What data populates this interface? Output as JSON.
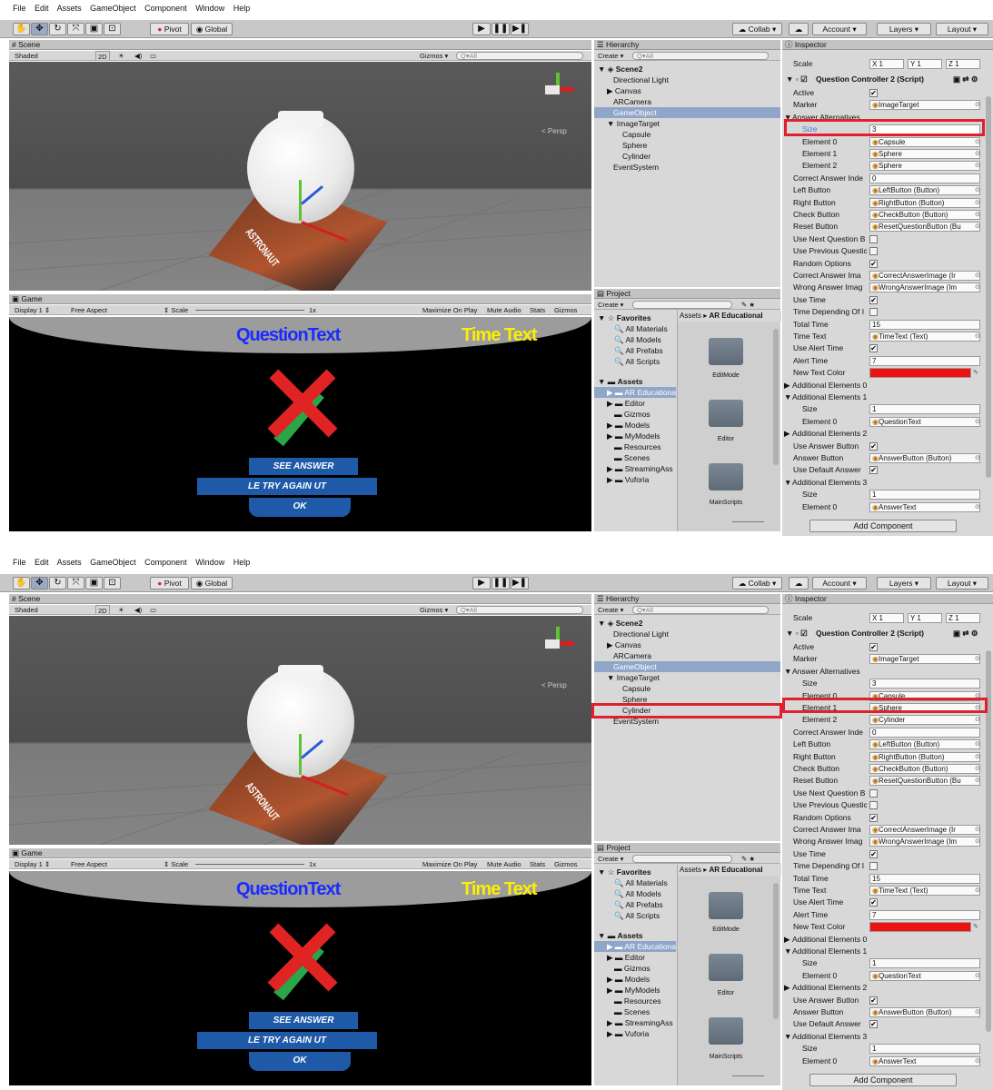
{
  "menu": [
    "File",
    "Edit",
    "Assets",
    "GameObject",
    "Component",
    "Window",
    "Help"
  ],
  "toolbar": {
    "pivot": "Pivot",
    "global": "Global",
    "collab": "Collab",
    "account": "Account",
    "layers": "Layers",
    "layout": "Layout",
    "play": "▶",
    "pause": "❚❚",
    "step": "▶❚"
  },
  "scene": {
    "tab": "Scene",
    "shading": "Shaded",
    "mode2d": "2D",
    "gizmos": "Gizmos",
    "search": "All",
    "persp": "< Persp",
    "card_label": "ASTRONAUT"
  },
  "game": {
    "tab": "Game",
    "display": "Display 1",
    "aspect": "Free Aspect",
    "scale": "Scale",
    "scale_val": "1x",
    "maximize": "Maximize On Play",
    "mute": "Mute Audio",
    "stats": "Stats",
    "gizmos": "Gizmos",
    "question_text": "QuestionText",
    "time_text": "Time Text",
    "see_answer": "SEE ANSWER",
    "try_again": "LE  TRY AGAIN  UT",
    "ok": "OK"
  },
  "hierarchy": {
    "tab": "Hierarchy",
    "create": "Create",
    "search": "All",
    "scene": "Scene2",
    "items": [
      "Directional Light",
      "Canvas",
      "ARCamera",
      "GameObject",
      "ImageTarget",
      "Capsule",
      "Sphere",
      "Cylinder",
      "EventSystem"
    ]
  },
  "project": {
    "tab": "Project",
    "create": "Create",
    "favorites": "Favorites",
    "fav_items": [
      "All Materials",
      "All Models",
      "All Prefabs",
      "All Scripts"
    ],
    "assets": "Assets",
    "asset_items": [
      "AR Educationa",
      "Editor",
      "Gizmos",
      "Models",
      "MyModels",
      "Resources",
      "Scenes",
      "StreamingAss",
      "Vuforia"
    ],
    "breadcrumb_root": "Assets",
    "breadcrumb_current": "AR Educational",
    "folders": [
      "EditMode",
      "Editor",
      "MainScripts"
    ]
  },
  "inspector_common": {
    "tab": "Inspector",
    "component": "Question Controller 2 (Script)",
    "add_component": "Add Component",
    "scale_label": "Scale",
    "sx": "X 1",
    "sy": "Y 1",
    "sz": "Z 1"
  },
  "shot1": {
    "rows": [
      [
        "Active",
        "chk"
      ],
      [
        "Marker",
        "ImageTarget"
      ],
      [
        "Answer Alternatives",
        ""
      ],
      [
        "Size",
        "3"
      ],
      [
        "Element 0",
        "Capsule"
      ],
      [
        "Element 1",
        "Sphere"
      ],
      [
        "Element 2",
        "Sphere"
      ],
      [
        "Correct Answer Inde",
        "0"
      ],
      [
        "Left Button",
        "LeftButton (Button)"
      ],
      [
        "Right Button",
        "RightButton (Button)"
      ],
      [
        "Check Button",
        "CheckButton (Button)"
      ],
      [
        "Reset Button",
        "ResetQuestionButton (Bu"
      ],
      [
        "Use Next Question B",
        "box"
      ],
      [
        "Use Previous Questic",
        "box"
      ],
      [
        "Random Options",
        "chk"
      ],
      [
        "Correct Answer Ima",
        "CorrectAnswerImage (Ir"
      ],
      [
        "Wrong Answer Imag",
        "WrongAnswerImage (Im"
      ],
      [
        "Use Time",
        "chk"
      ],
      [
        "Time Depending Of I",
        "box"
      ],
      [
        "Total Time",
        "15"
      ],
      [
        "Time Text",
        "TimeText (Text)"
      ],
      [
        "Use Alert Time",
        "chk"
      ],
      [
        "Alert Time",
        "7"
      ],
      [
        "New Text Color",
        "color"
      ],
      [
        "Additional Elements 0",
        ""
      ],
      [
        "Additional Elements 1",
        ""
      ],
      [
        "Size",
        "1"
      ],
      [
        "Element 0",
        "QuestionText"
      ],
      [
        "Additional Elements 2",
        ""
      ],
      [
        "Use Answer Button",
        "chk"
      ],
      [
        "Answer Button",
        "AnswerButton (Button)"
      ],
      [
        "Use Default Answer",
        "chk"
      ],
      [
        "Additional Elements 3",
        ""
      ],
      [
        "Size",
        "1"
      ],
      [
        "Element 0",
        "AnswerText"
      ]
    ]
  },
  "shot2": {
    "rows": [
      [
        "Active",
        "chk"
      ],
      [
        "Marker",
        "ImageTarget"
      ],
      [
        "Answer Alternatives",
        ""
      ],
      [
        "Size",
        "3"
      ],
      [
        "Element 0",
        "Capsule"
      ],
      [
        "Element 1",
        "Sphere"
      ],
      [
        "Element 2",
        "Cylinder"
      ],
      [
        "Correct Answer Inde",
        "0"
      ],
      [
        "Left Button",
        "LeftButton (Button)"
      ],
      [
        "Right Button",
        "RightButton (Button)"
      ],
      [
        "Check Button",
        "CheckButton (Button)"
      ],
      [
        "Reset Button",
        "ResetQuestionButton (Bu"
      ],
      [
        "Use Next Question B",
        "box"
      ],
      [
        "Use Previous Questic",
        "box"
      ],
      [
        "Random Options",
        "chk"
      ],
      [
        "Correct Answer Ima",
        "CorrectAnswerImage (Ir"
      ],
      [
        "Wrong Answer Imag",
        "WrongAnswerImage (Im"
      ],
      [
        "Use Time",
        "chk"
      ],
      [
        "Time Depending Of I",
        "box"
      ],
      [
        "Total Time",
        "15"
      ],
      [
        "Time Text",
        "TimeText (Text)"
      ],
      [
        "Use Alert Time",
        "chk"
      ],
      [
        "Alert Time",
        "7"
      ],
      [
        "New Text Color",
        "color"
      ],
      [
        "Additional Elements 0",
        ""
      ],
      [
        "Additional Elements 1",
        ""
      ],
      [
        "Size",
        "1"
      ],
      [
        "Element 0",
        "QuestionText"
      ],
      [
        "Additional Elements 2",
        ""
      ],
      [
        "Use Answer Button",
        "chk"
      ],
      [
        "Answer Button",
        "AnswerButton (Button)"
      ],
      [
        "Use Default Answer",
        "chk"
      ],
      [
        "Additional Elements 3",
        ""
      ],
      [
        "Size",
        "1"
      ],
      [
        "Element 0",
        "AnswerText"
      ]
    ]
  },
  "colors": {
    "highlight": "#e0202c",
    "selection": "#3e7dd6",
    "text_color_swatch": "#ee1111",
    "question_text": "#1a2cff",
    "time_text": "#ffee00"
  }
}
